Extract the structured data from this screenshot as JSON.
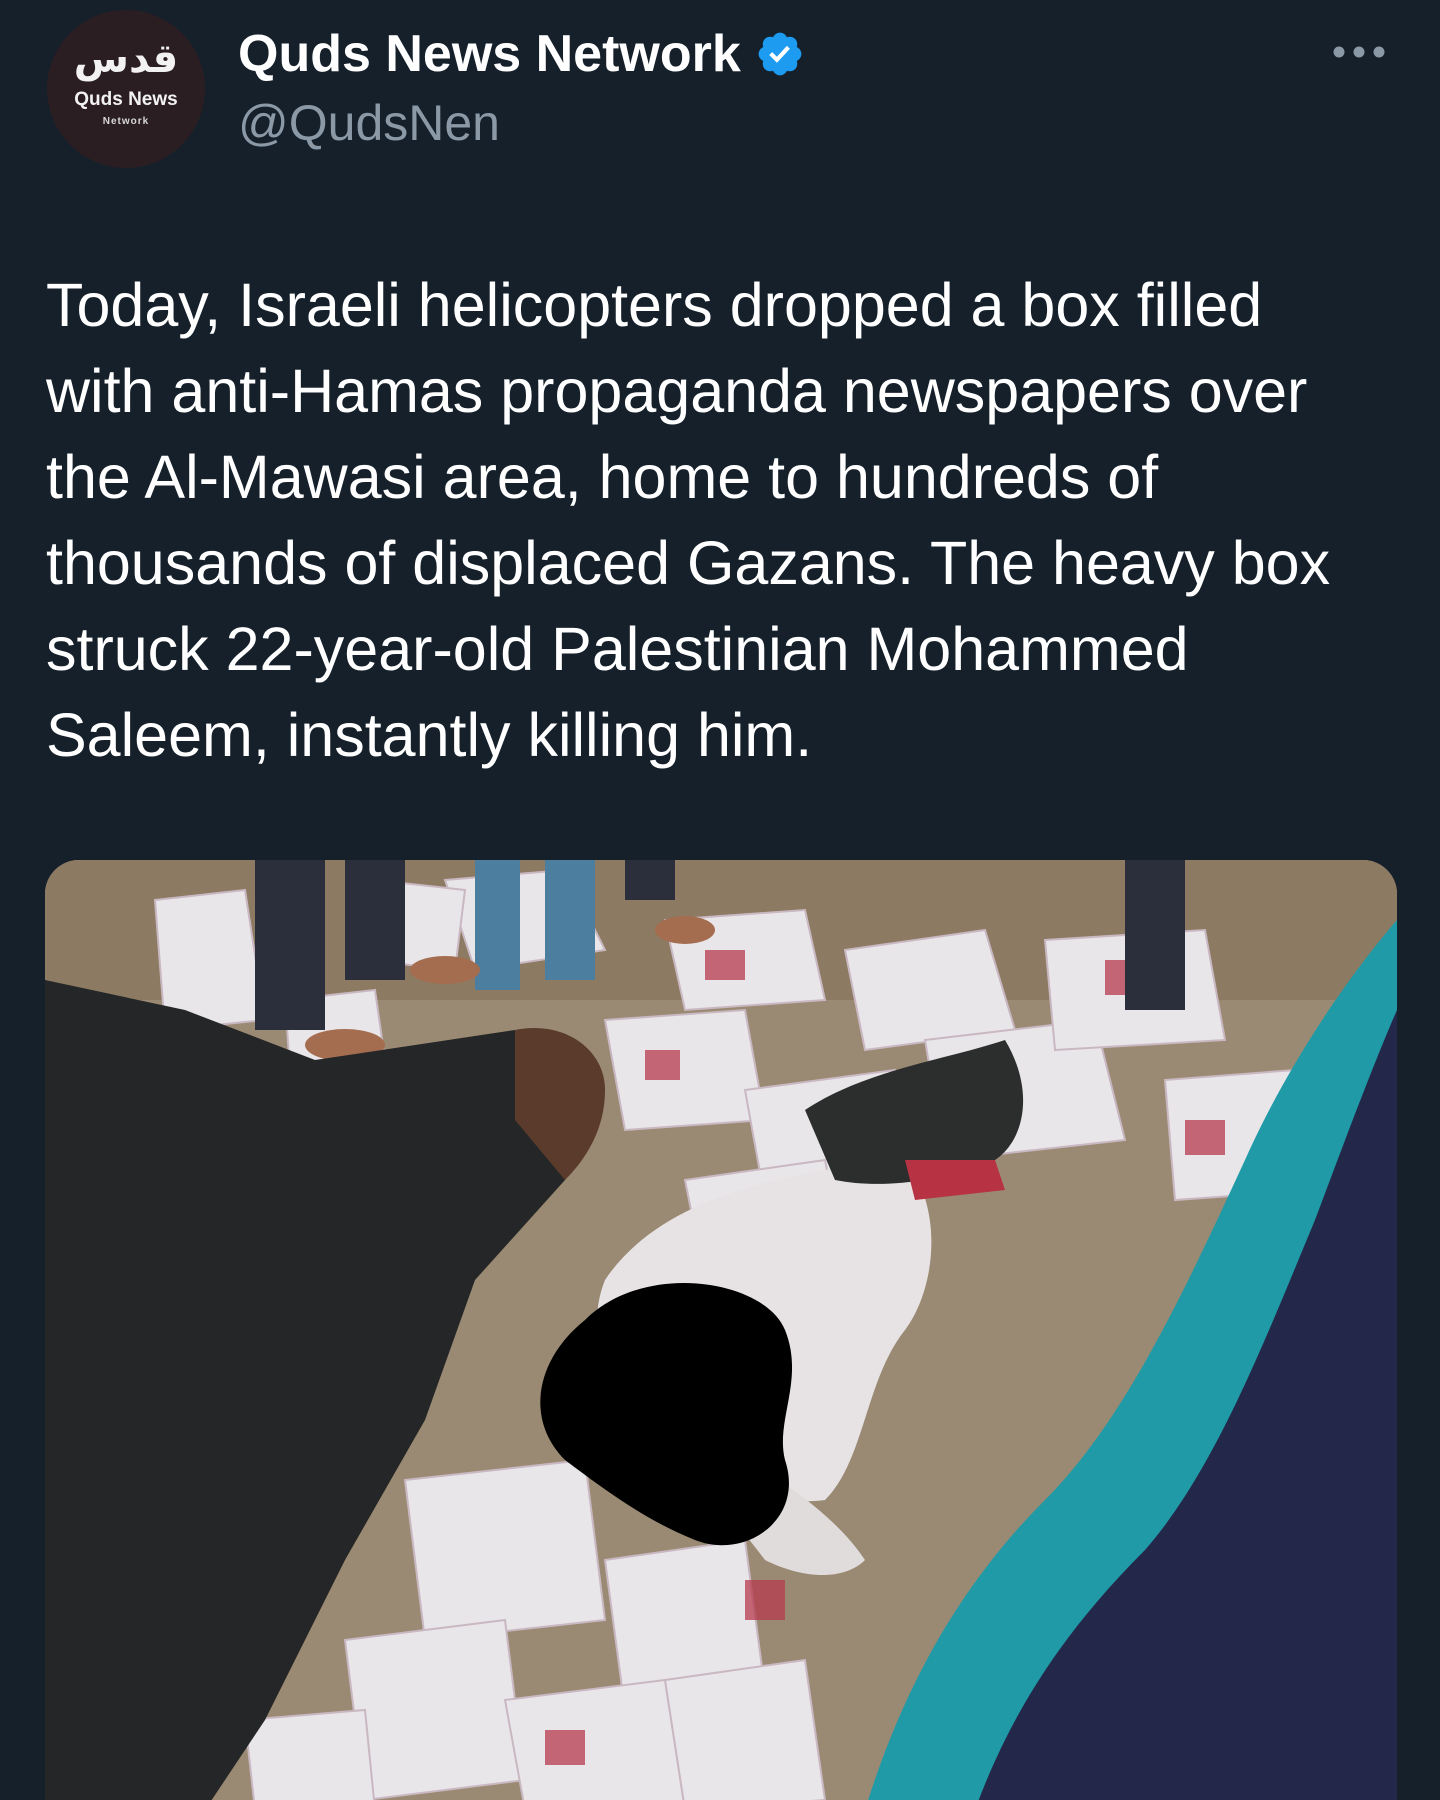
{
  "account": {
    "display_name": "Quds News Network",
    "handle": "@QudsNen",
    "verified": true,
    "avatar_arabic": "قدس",
    "avatar_line1": "Quds News",
    "avatar_line2": "Network"
  },
  "tweet": {
    "text": "Today, Israeli helicopters dropped a box filled\nwith anti-Hamas propaganda newspapers over\nthe Al-Mawasi area, home to hundreds of\nthousands of displaced Gazans. The heavy box\nstruck 22-year-old Palestinian Mohammed\nSaleem, instantly killing him."
  },
  "media": {
    "kind": "photo"
  },
  "icons": {
    "verified": "verified-badge-icon",
    "more": "more-options-icon"
  },
  "colors": {
    "background": "#15202b",
    "text": "#ffffff",
    "secondary_text": "#8b98a5",
    "verified_blue": "#1d9bf0"
  }
}
